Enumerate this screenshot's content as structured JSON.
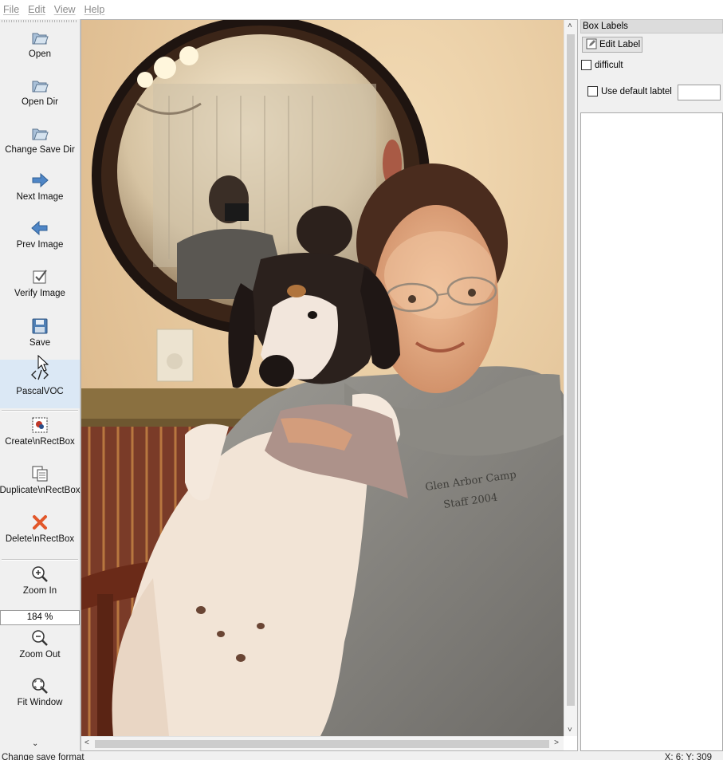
{
  "menubar": {
    "items": [
      "File",
      "Edit",
      "View",
      "Help"
    ]
  },
  "toolbar": {
    "items": [
      {
        "label": "Open",
        "icon": "open-folder-icon"
      },
      {
        "label": "Open Dir",
        "icon": "open-folder-icon"
      },
      {
        "label": "Change Save Dir",
        "icon": "open-folder-icon"
      },
      {
        "label": "Next Image",
        "icon": "next-arrow-icon"
      },
      {
        "label": "Prev Image",
        "icon": "prev-arrow-icon"
      },
      {
        "label": "Verify Image",
        "icon": "verify-check-icon"
      },
      {
        "label": "Save",
        "icon": "floppy-disk-icon"
      },
      {
        "label": "PascalVOC",
        "icon": "xml-code-icon"
      },
      {
        "label": "Create\\nRectBox",
        "icon": "create-rectbox-icon"
      },
      {
        "label": "Duplicate\\nRectBox",
        "icon": "duplicate-rectbox-icon"
      },
      {
        "label": "Delete\\nRectBox",
        "icon": "delete-x-icon"
      },
      {
        "label": "Zoom In",
        "icon": "zoom-in-icon"
      },
      {
        "label": "Zoom Out",
        "icon": "zoom-out-icon"
      },
      {
        "label": "Fit Window",
        "icon": "fit-window-icon"
      }
    ],
    "zoom_value": "184 %"
  },
  "dock": {
    "title": "Box Labels",
    "edit_label_button": "Edit Label",
    "difficult_label": "difficult",
    "use_default_label": "Use default labtel",
    "default_label_value": ""
  },
  "status": {
    "message": "Change save format",
    "position": "X: 6; Y: 309"
  },
  "colors": {
    "accent_active": "#dbe8f5",
    "delete_icon": "#e2572a",
    "arrow_icon": "#4f86c6"
  }
}
